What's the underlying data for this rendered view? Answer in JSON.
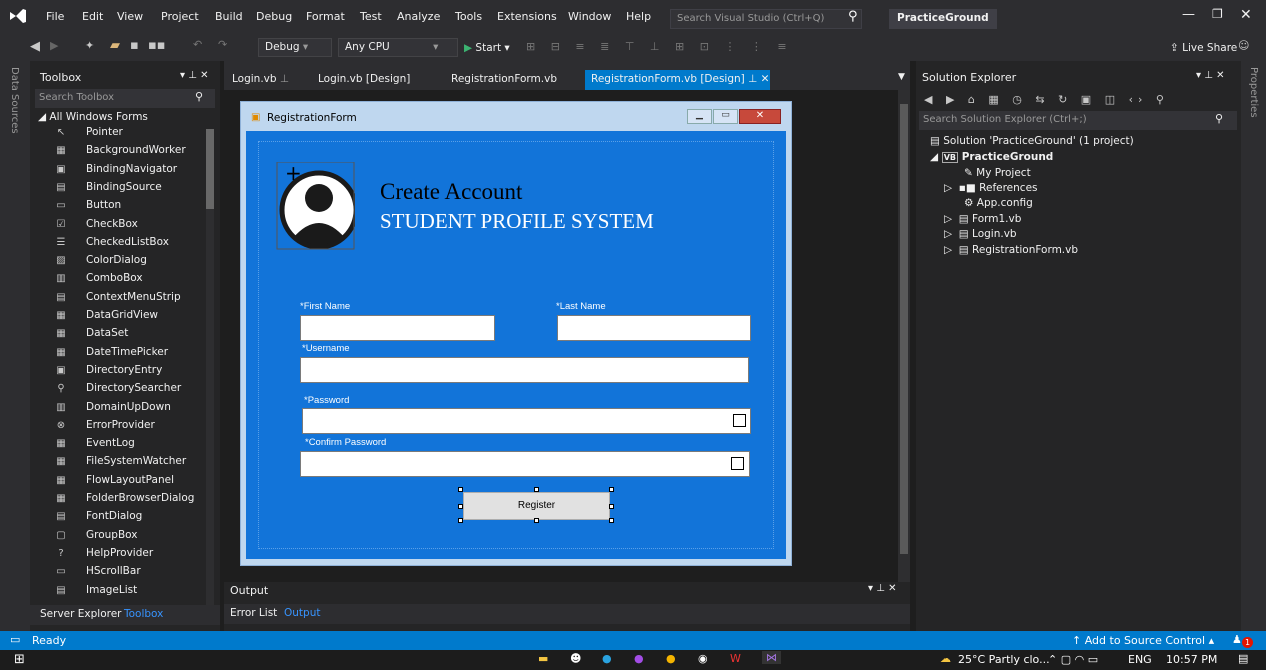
{
  "menu": {
    "items": [
      "File",
      "Edit",
      "View",
      "Project",
      "Build",
      "Debug",
      "Format",
      "Test",
      "Analyze",
      "Tools",
      "Extensions",
      "Window",
      "Help"
    ],
    "search_placeholder": "Search Visual Studio (Ctrl+Q)",
    "solution_title": "PracticeGround"
  },
  "toolbar": {
    "config": "Debug",
    "platform": "Any CPU",
    "start_label": "Start",
    "live_share": "Live Share"
  },
  "side": {
    "data_sources": "Data Sources",
    "properties": "Properties"
  },
  "toolbox": {
    "title": "Toolbox",
    "search_placeholder": "Search Toolbox",
    "group": "All Windows Forms",
    "items": [
      "Pointer",
      "BackgroundWorker",
      "BindingNavigator",
      "BindingSource",
      "Button",
      "CheckBox",
      "CheckedListBox",
      "ColorDialog",
      "ComboBox",
      "ContextMenuStrip",
      "DataGridView",
      "DataSet",
      "DateTimePicker",
      "DirectoryEntry",
      "DirectorySearcher",
      "DomainUpDown",
      "ErrorProvider",
      "EventLog",
      "FileSystemWatcher",
      "FlowLayoutPanel",
      "FolderBrowserDialog",
      "FontDialog",
      "GroupBox",
      "HelpProvider",
      "HScrollBar",
      "ImageList"
    ],
    "bottom_tabs": [
      "Server Explorer",
      "Toolbox"
    ]
  },
  "tabs": [
    "Login.vb",
    "Login.vb [Design]",
    "RegistrationForm.vb",
    "RegistrationForm.vb [Design]"
  ],
  "form": {
    "title": "RegistrationForm",
    "heading1": "Create Account",
    "heading2": "STUDENT PROFILE SYSTEM",
    "first_name": "*First Name",
    "last_name": "*Last Name",
    "username": "*Username",
    "password": "*Password",
    "confirm_password": "*Confirm Password",
    "register": "Register"
  },
  "output": {
    "title": "Output",
    "tabs": [
      "Error List",
      "Output"
    ]
  },
  "solution": {
    "title": "Solution Explorer",
    "search_placeholder": "Search Solution Explorer (Ctrl+;)",
    "root": "Solution 'PracticeGround' (1 project)",
    "project": "PracticeGround",
    "items": [
      "My Project",
      "References",
      "App.config",
      "Form1.vb",
      "Login.vb",
      "RegistrationForm.vb"
    ]
  },
  "status": {
    "ready": "Ready",
    "source_control": "Add to Source Control",
    "notification_count": "1"
  },
  "taskbar": {
    "weather": "25°C  Partly clo...",
    "language": "ENG",
    "time": "10:57 PM"
  }
}
